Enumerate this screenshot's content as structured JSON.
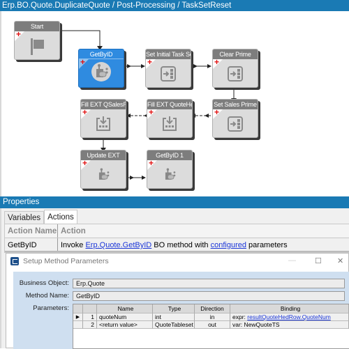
{
  "window": {
    "title": "Erp.BO.Quote.DuplicateQuote / Post-Processing / TaskSetReset"
  },
  "workflow": {
    "nodes": [
      {
        "id": "start",
        "label": "Start",
        "icon": "flag-icon",
        "selected": false
      },
      {
        "id": "getbyid",
        "label": "GetByID",
        "icon": "invoke-bo-method-icon",
        "selected": true
      },
      {
        "id": "set-initial-task-set",
        "label": "Set Initial Task Set",
        "icon": "set-field-icon",
        "selected": false
      },
      {
        "id": "clear-prime",
        "label": "Clear Prime",
        "icon": "set-field-icon",
        "selected": false
      },
      {
        "id": "set-sales-prime",
        "label": "Set Sales Prime",
        "icon": "set-field-icon",
        "selected": false
      },
      {
        "id": "fill-ext-quotehed",
        "label": "Fill EXT QuoteHed",
        "icon": "fill-table-icon",
        "selected": false
      },
      {
        "id": "fill-ext-qsalesrp",
        "label": "Fill EXT QSalesRP",
        "icon": "fill-table-icon",
        "selected": false
      },
      {
        "id": "update-ext",
        "label": "Update EXT",
        "icon": "invoke-bo-method-icon",
        "selected": false
      },
      {
        "id": "getbyid-1",
        "label": "GetByID 1",
        "icon": "invoke-bo-method-icon",
        "selected": false
      }
    ]
  },
  "properties": {
    "title": "Properties",
    "tabs": [
      {
        "label": "Variables",
        "active": false
      },
      {
        "label": "Actions",
        "active": true
      }
    ],
    "columns": {
      "name": "Action Name",
      "action": "Action"
    },
    "row": {
      "name": "GetByID",
      "prefix": "Invoke ",
      "link1": "Erp.Quote.GetByID",
      "middle": " BO method with ",
      "link2": "configured",
      "suffix": " parameters"
    }
  },
  "dialog": {
    "title": "Setup Method Parameters",
    "controls": {
      "minimize": "—",
      "maximize": "☐",
      "close": "✕"
    },
    "business_object_label": "Business Object:",
    "business_object": "Erp.Quote",
    "method_name_label": "Method Name:",
    "method_name": "GetByID",
    "parameters_label": "Parameters:",
    "columns": {
      "name": "Name",
      "type": "Type",
      "direction": "Direction",
      "binding": "Binding"
    },
    "params": [
      {
        "num": "1",
        "name": "quoteNum",
        "type": "int",
        "direction": "in",
        "binding_prefix": "expr: ",
        "binding_link": "resultQuoteHedRow.QuoteNum",
        "current": true
      },
      {
        "num": "2",
        "name": "<return value>",
        "type": "QuoteTableset",
        "direction": "out",
        "binding_prefix": "var: NewQuoteTS",
        "binding_link": "",
        "current": false
      }
    ]
  }
}
